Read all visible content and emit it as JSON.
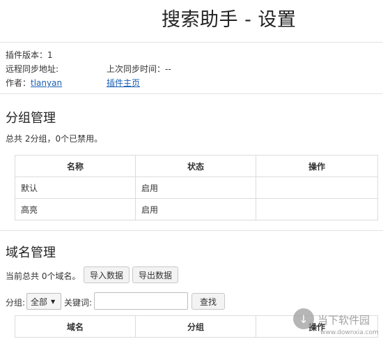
{
  "page": {
    "title": "搜索助手 - 设置"
  },
  "info": {
    "version": "插件版本：1",
    "remote_sync_url": "远程同步地址:",
    "last_sync": "上次同步时间：--",
    "author_label": "作者：",
    "author_link": "tlanyan",
    "homepage_link": "插件主页"
  },
  "group_section": {
    "heading": "分组管理",
    "summary": "总共 2分组，0个已禁用。",
    "columns": [
      "名称",
      "状态",
      "操作"
    ],
    "rows": [
      {
        "name": "默认",
        "status": "启用",
        "action": ""
      },
      {
        "name": "高亮",
        "status": "启用",
        "action": ""
      }
    ]
  },
  "domain_section": {
    "heading": "域名管理",
    "summary": "当前总共 0个域名。",
    "import_button": "导入数据",
    "export_button": "导出数据",
    "group_label": "分组:",
    "group_select": "全部",
    "keyword_label": "关键词:",
    "keyword_value": "",
    "search_button": "查找",
    "columns": [
      "域名",
      "分组",
      "操作"
    ]
  },
  "watermark": {
    "text": "当下软件园",
    "sub": "www.downxia.com"
  }
}
